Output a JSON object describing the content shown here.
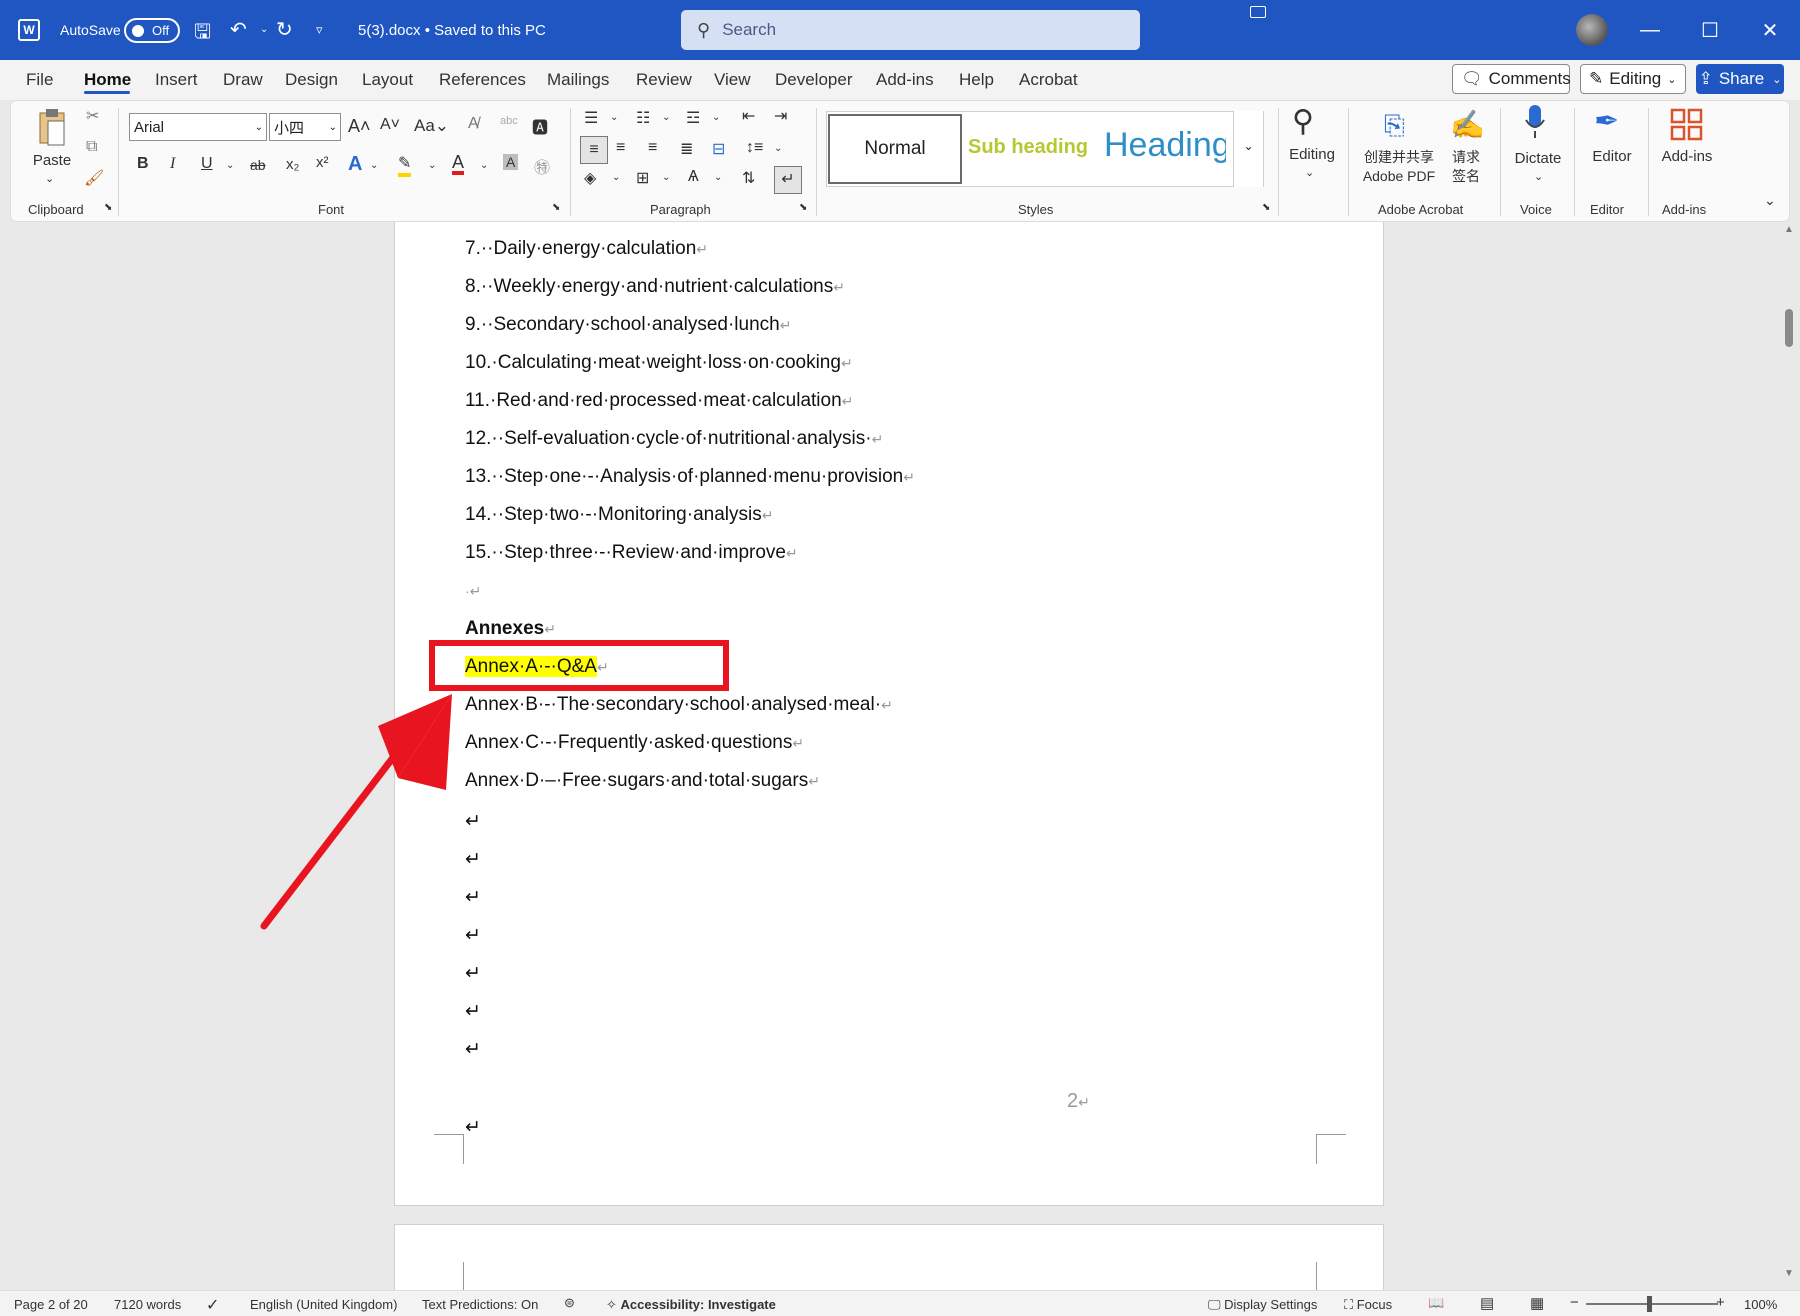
{
  "titlebar": {
    "app_icon": "W",
    "autosave_label": "AutoSave",
    "autosave_state": "Off",
    "doc_title": "5(3).docx • Saved to this PC",
    "search_placeholder": "Search"
  },
  "tabs": [
    "File",
    "Home",
    "Insert",
    "Draw",
    "Design",
    "Layout",
    "References",
    "Mailings",
    "Review",
    "View",
    "Developer",
    "Add-ins",
    "Help",
    "Acrobat"
  ],
  "menu_right": {
    "comments": "Comments",
    "editing": "Editing",
    "share": "Share"
  },
  "ribbon": {
    "paste": "Paste",
    "font_name": "Arial",
    "font_size": "小四",
    "bold": "B",
    "italic": "I",
    "underline": "U",
    "strike": "ab",
    "style_normal": "Normal",
    "style_sub": "Sub heading",
    "style_heading": "Heading",
    "editing": "Editing",
    "acrobat_create": "创建并共享 Adobe PDF",
    "acrobat_sign": "请求 签名",
    "dictate": "Dictate",
    "editor": "Editor",
    "addins": "Add-ins",
    "groups": {
      "clipboard": "Clipboard",
      "font": "Font",
      "paragraph": "Paragraph",
      "styles": "Styles",
      "adobe": "Adobe Acrobat",
      "voice": "Voice",
      "editor": "Editor",
      "addins": "Add-ins"
    }
  },
  "document": {
    "list": [
      "7.··Daily·energy·calculation",
      "8.··Weekly·energy·and·nutrient·calculations",
      "9.··Secondary·school·analysed·lunch",
      "10.·Calculating·meat·weight·loss·on·cooking",
      "11.·Red·and·red·processed·meat·calculation",
      "12.··Self-evaluation·cycle·of·nutritional·analysis·",
      "13.··Step·one·-·Analysis·of·planned·menu·provision",
      "14.··Step·two·-·Monitoring·analysis",
      "15.··Step·three·-·Review·and·improve"
    ],
    "blank_dot": "·",
    "annexes_heading": "Annexes",
    "annex_a": "Annex·A·-·Q&A",
    "annex_b": "Annex·B·-·The·secondary·school·analysed·meal·",
    "annex_c": "Annex·C·-·Frequently·asked·questions",
    "annex_d": "Annex·D·–·Free·sugars·and·total·sugars",
    "para_mark": "↵",
    "page_number": "2"
  },
  "statusbar": {
    "page": "Page 2 of 20",
    "words": "7120 words",
    "language": "English (United Kingdom)",
    "predictions": "Text Predictions: On",
    "accessibility": "Accessibility: Investigate",
    "display": "Display Settings",
    "focus": "Focus",
    "zoom": "100%"
  },
  "colors": {
    "title_bar": "#1f56c2",
    "annotation": "#e8141f",
    "highlight": "#ffff00"
  }
}
